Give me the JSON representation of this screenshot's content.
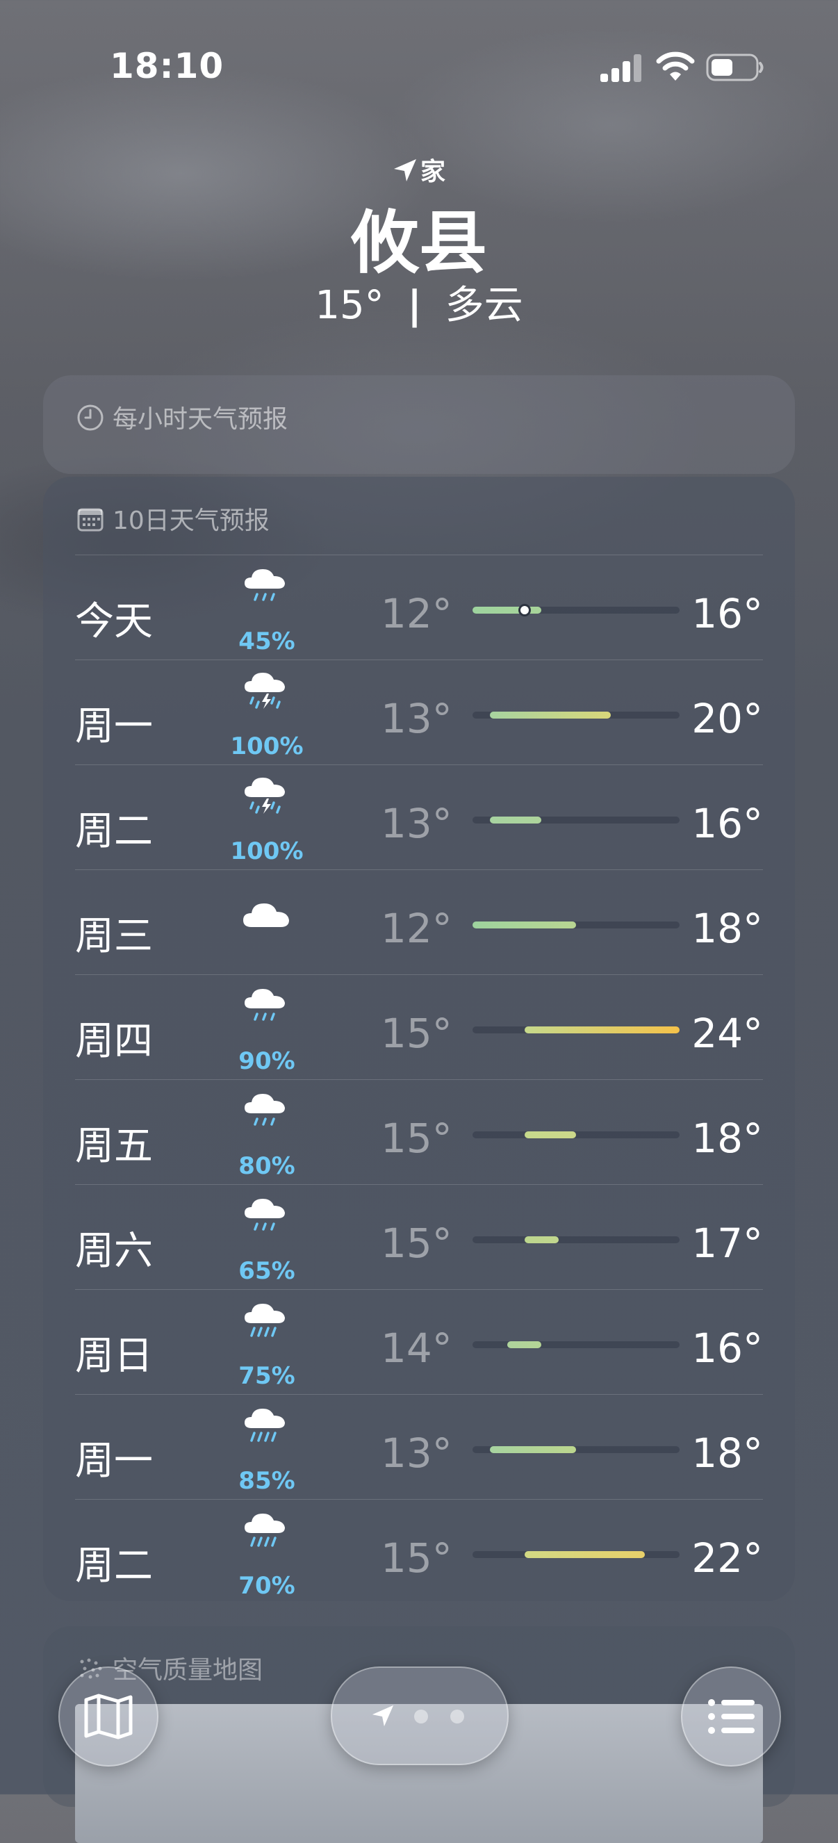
{
  "status_bar": {
    "time": "18:10"
  },
  "header": {
    "location_label": "家",
    "city": "攸县",
    "temp": "15°",
    "separator": "|",
    "condition": "多云"
  },
  "hourly_panel": {
    "title": "每小时天气预报"
  },
  "forecast": {
    "title": "10日天气预报",
    "range_min": 12,
    "range_max": 24,
    "days": [
      {
        "day": "今天",
        "icon": "cloud-rain-icon",
        "precip": "45%",
        "low": "12°",
        "high": "16°",
        "low_val": 12,
        "high_val": 16,
        "current_val": 15,
        "bar_colors": [
          "#9ed39e",
          "#a8d49a"
        ]
      },
      {
        "day": "周一",
        "icon": "cloud-bolt-rain-icon",
        "precip": "100%",
        "low": "13°",
        "high": "20°",
        "low_val": 13,
        "high_val": 20,
        "bar_colors": [
          "#a7d3a0",
          "#d9d77a"
        ]
      },
      {
        "day": "周二",
        "icon": "cloud-bolt-rain-icon",
        "precip": "100%",
        "low": "13°",
        "high": "16°",
        "low_val": 13,
        "high_val": 16,
        "bar_colors": [
          "#a7d3a0",
          "#aed49c"
        ]
      },
      {
        "day": "周三",
        "icon": "cloud-icon",
        "precip": "",
        "low": "12°",
        "high": "18°",
        "low_val": 12,
        "high_val": 18,
        "bar_colors": [
          "#9ed39e",
          "#b9d592"
        ]
      },
      {
        "day": "周四",
        "icon": "cloud-rain-icon",
        "precip": "90%",
        "low": "15°",
        "high": "24°",
        "low_val": 15,
        "high_val": 24,
        "bar_colors": [
          "#c6d98c",
          "#f5c24a"
        ]
      },
      {
        "day": "周五",
        "icon": "cloud-rain-icon",
        "precip": "80%",
        "low": "15°",
        "high": "18°",
        "low_val": 15,
        "high_val": 18,
        "bar_colors": [
          "#c6d98c",
          "#cdd88a"
        ]
      },
      {
        "day": "周六",
        "icon": "cloud-rain-icon",
        "precip": "65%",
        "low": "15°",
        "high": "17°",
        "low_val": 15,
        "high_val": 17,
        "bar_colors": [
          "#bcd68e",
          "#c2d78e"
        ]
      },
      {
        "day": "周日",
        "icon": "cloud-heavy-rain-icon",
        "precip": "75%",
        "low": "14°",
        "high": "16°",
        "low_val": 14,
        "high_val": 16,
        "bar_colors": [
          "#aed49c",
          "#b6d596"
        ]
      },
      {
        "day": "周一",
        "icon": "cloud-heavy-rain-icon",
        "precip": "85%",
        "low": "13°",
        "high": "18°",
        "low_val": 13,
        "high_val": 18,
        "bar_colors": [
          "#a7d3a0",
          "#bcd68e"
        ]
      },
      {
        "day": "周二",
        "icon": "cloud-heavy-rain-icon",
        "precip": "70%",
        "low": "15°",
        "high": "22°",
        "low_val": 15,
        "high_val": 22,
        "bar_colors": [
          "#d2d984",
          "#e8d06a"
        ]
      }
    ]
  },
  "air_quality_panel": {
    "title": "空气质量地图"
  },
  "bottom_bar": {
    "map_button": "map-icon",
    "list_button": "list-icon",
    "page_dots": 2
  }
}
